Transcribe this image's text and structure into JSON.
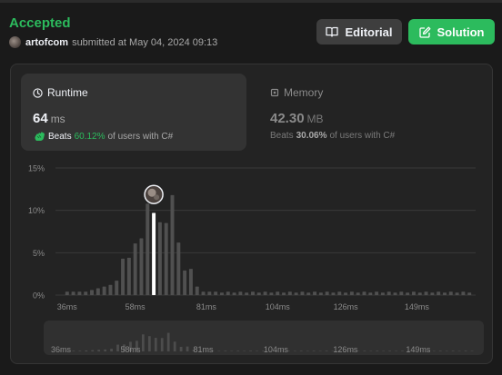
{
  "submission": {
    "status": "Accepted",
    "user": "artofcom",
    "submitted_text": "submitted at May 04, 2024 09:13"
  },
  "buttons": {
    "editorial": "Editorial",
    "solution": "Solution"
  },
  "runtime": {
    "title": "Runtime",
    "value": "64",
    "unit": "ms",
    "beats_label": "Beats",
    "beats_pct": "60.12%",
    "beats_suffix": "of users with C#"
  },
  "memory": {
    "title": "Memory",
    "value": "42.30",
    "unit": "MB",
    "beats_label": "Beats",
    "beats_pct": "30.06%",
    "beats_suffix": "of users with C#"
  },
  "colors": {
    "accent_green": "#2cbb5d",
    "bar": "#505050",
    "selected_bar": "#ffffff"
  },
  "icons": {
    "editorial": "book-icon",
    "solution": "edit-icon",
    "runtime": "clock-icon",
    "memory": "chip-icon",
    "beats": "clap-icon"
  },
  "chart_data": {
    "type": "bar",
    "x": [
      36,
      38,
      40,
      42,
      44,
      46,
      48,
      50,
      52,
      54,
      56,
      58,
      60,
      62,
      64,
      66,
      68,
      70,
      72,
      74,
      76,
      78,
      80,
      82,
      84,
      86,
      88,
      90,
      92,
      94,
      96,
      98,
      100,
      102,
      104,
      106,
      108,
      110,
      112,
      114,
      116,
      118,
      120,
      122,
      124,
      126,
      128,
      130,
      132,
      134,
      136,
      138,
      140,
      142,
      144,
      146,
      148,
      150,
      152,
      154,
      156,
      158,
      160,
      162,
      164,
      166
    ],
    "values": [
      0.4,
      0.4,
      0.4,
      0.4,
      0.6,
      0.8,
      1.0,
      1.2,
      1.7,
      4.3,
      4.4,
      6.1,
      6.7,
      10.8,
      9.7,
      8.6,
      8.5,
      11.8,
      6.2,
      2.9,
      3.1,
      1.0,
      0.4,
      0.4,
      0.4,
      0.3,
      0.4,
      0.3,
      0.4,
      0.3,
      0.4,
      0.3,
      0.4,
      0.3,
      0.4,
      0.3,
      0.4,
      0.3,
      0.4,
      0.3,
      0.4,
      0.3,
      0.4,
      0.3,
      0.4,
      0.3,
      0.4,
      0.3,
      0.4,
      0.3,
      0.4,
      0.3,
      0.4,
      0.3,
      0.4,
      0.3,
      0.4,
      0.3,
      0.4,
      0.3,
      0.4,
      0.3,
      0.4,
      0.3,
      0.4,
      0.3
    ],
    "selected_x": 64,
    "xticks": [
      "36ms",
      "58ms",
      "81ms",
      "104ms",
      "126ms",
      "149ms"
    ],
    "xtick_values": [
      36,
      58,
      81,
      104,
      126,
      149
    ],
    "yticks": [
      "0%",
      "5%",
      "10%",
      "15%"
    ],
    "ytick_values": [
      0,
      5,
      10,
      15
    ],
    "ylim": [
      0,
      15
    ],
    "xlim": [
      34,
      168
    ],
    "grid": true
  }
}
